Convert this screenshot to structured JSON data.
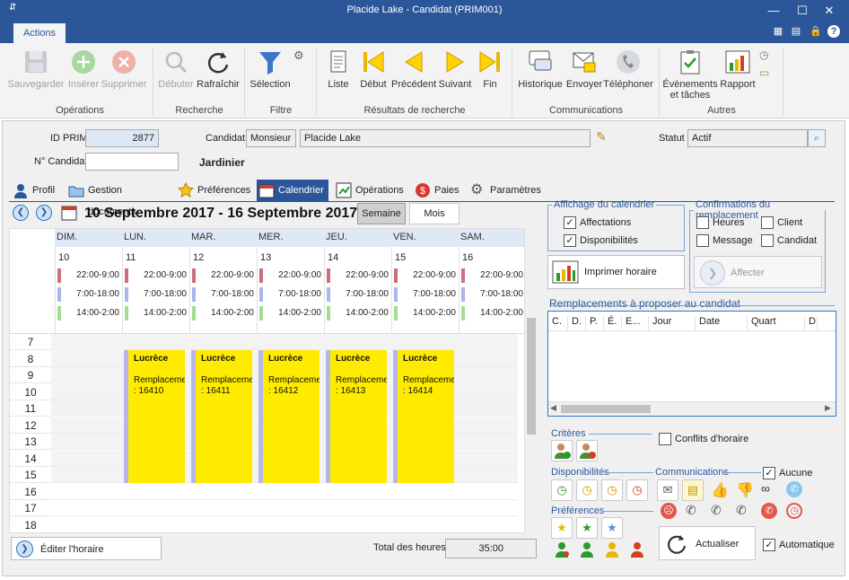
{
  "window": {
    "title": "Placide Lake - Candidat (PRIM001)"
  },
  "ribbon_tab": "Actions",
  "ribbon": {
    "buttons": [
      {
        "label": "Sauvegarder"
      },
      {
        "label": "Insérer"
      },
      {
        "label": "Supprimer"
      },
      {
        "label": "Débuter"
      },
      {
        "label": "Rafraîchir"
      },
      {
        "label": "Sélection"
      },
      {
        "label": "Liste"
      },
      {
        "label": "Début"
      },
      {
        "label": "Précédent"
      },
      {
        "label": "Suivant"
      },
      {
        "label": "Fin"
      },
      {
        "label": "Historique"
      },
      {
        "label": "Envoyer"
      },
      {
        "label": "Téléphoner"
      },
      {
        "label": "Évènements et tâches"
      },
      {
        "label": "Rapport"
      }
    ],
    "groups": [
      "Opérations",
      "Recherche",
      "Filtre",
      "Résultats de recherche",
      "Communications",
      "Autres"
    ]
  },
  "form": {
    "id_prim_label": "ID PRIM",
    "id_prim_value": "2877",
    "candidat_label": "Candidat",
    "title_value": "Monsieur",
    "name_value": "Placide Lake",
    "statut_label": "Statut",
    "statut_value": "Actif",
    "no_candidat_label": "N° Candidat",
    "no_candidat_value": "",
    "job": "Jardinier"
  },
  "tabs": [
    "Profil",
    "Gestion documents",
    "Préférences",
    "Calendrier",
    "Opérations",
    "Paies",
    "Paramètres"
  ],
  "calendar": {
    "range": "10 Septembre 2017 - 16 Septembre 2017",
    "view_week": "Semaine",
    "view_month": "Mois",
    "days": [
      {
        "name": "DIM.",
        "num": "10"
      },
      {
        "name": "LUN.",
        "num": "11"
      },
      {
        "name": "MAR.",
        "num": "12"
      },
      {
        "name": "MER.",
        "num": "13"
      },
      {
        "name": "JEU.",
        "num": "14"
      },
      {
        "name": "VEN.",
        "num": "15"
      },
      {
        "name": "SAM.",
        "num": "16"
      }
    ],
    "shifts": [
      "22:00-9:00",
      "7:00-18:00",
      "14:00-2:00"
    ],
    "shift_colors": [
      "#c9707a",
      "#aab4ee",
      "#9ee08e"
    ],
    "hours": [
      "7",
      "8",
      "9",
      "10",
      "11",
      "12",
      "13",
      "14",
      "15",
      "16",
      "17",
      "18"
    ],
    "events": [
      {
        "name": "Lucrèce",
        "text": "Remplaceme",
        "id": ": 16410"
      },
      {
        "name": "Lucrèce",
        "text": "Remplaceme",
        "id": ": 16411"
      },
      {
        "name": "Lucrèce",
        "text": "Remplaceme",
        "id": ": 16412"
      },
      {
        "name": "Lucrèce",
        "text": "Remplaceme",
        "id": ": 16413"
      },
      {
        "name": "Lucrèce",
        "text": "Remplaceme",
        "id": ": 16414"
      }
    ],
    "edit_button": "Éditer l'horaire",
    "total_label": "Total des heures",
    "total_value": "35:00"
  },
  "display": {
    "legend": "Affichage du calendrier",
    "affectations": "Affectations",
    "disponibilites": "Disponibilités",
    "print": "Imprimer horaire"
  },
  "confirm": {
    "legend": "Confirmations du remplacement",
    "heures": "Heures",
    "client": "Client",
    "message": "Message",
    "candidat": "Candidat",
    "affecter": "Affecter"
  },
  "replacements": {
    "legend": "Remplacements à proposer au candidat",
    "columns": [
      "C.",
      "D.",
      "P.",
      "É.",
      "E...",
      "Jour",
      "Date",
      "Quart",
      "D"
    ]
  },
  "criteria": {
    "criteres": "Critères",
    "conflits": "Conflits d'horaire",
    "disponibilites": "Disponibilités",
    "communications": "Communications",
    "aucune": "Aucune",
    "preferences": "Préférences",
    "actualiser": "Actualiser",
    "automatique": "Automatique"
  }
}
